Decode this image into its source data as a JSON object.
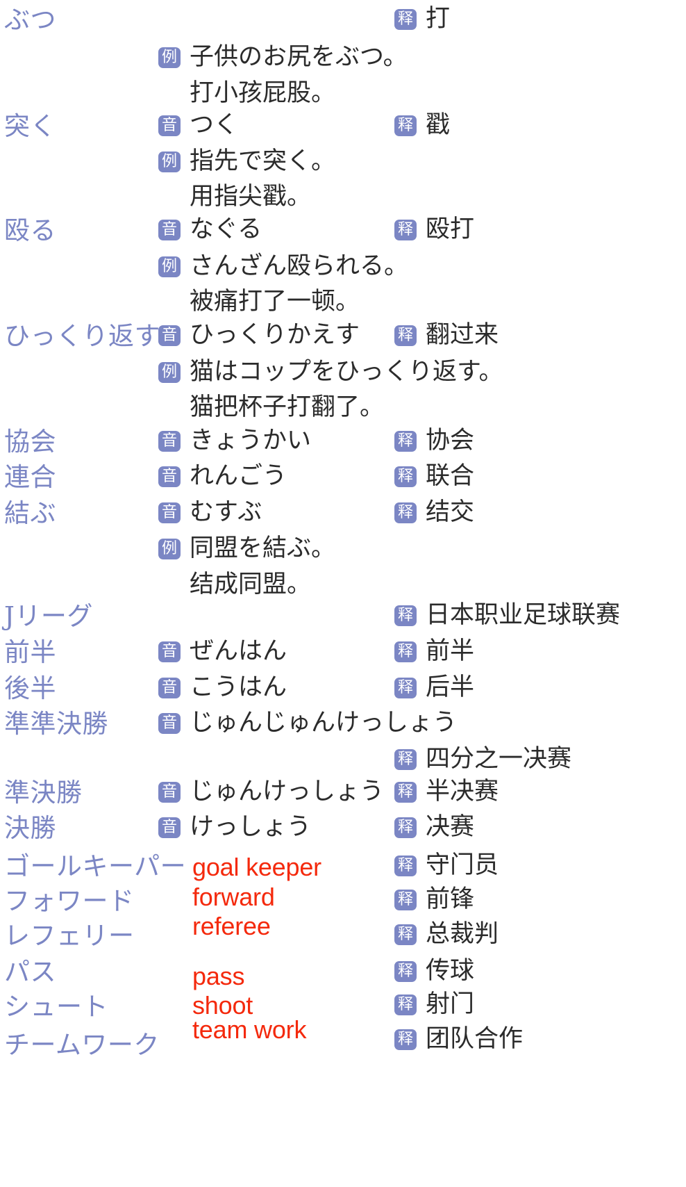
{
  "badges": {
    "reading": "音",
    "example": "例",
    "gloss": "释"
  },
  "colors": {
    "headword": "#7b86c4",
    "badge_bg": "#7b86c4",
    "body_text": "#2b2b2b",
    "annotation": "#f4290c",
    "page_bg": "#ffffff"
  },
  "entries": [
    {
      "headword": "ぶつ",
      "reading": "",
      "gloss": "打",
      "example_ja": "子供のお尻をぶつ。",
      "example_zh": "打小孩屁股。",
      "annotation": ""
    },
    {
      "headword": "突く",
      "reading": "つく",
      "gloss": "戳",
      "example_ja": "指先で突く。",
      "example_zh": "用指尖戳。",
      "annotation": ""
    },
    {
      "headword": "殴る",
      "reading": "なぐる",
      "gloss": "殴打",
      "example_ja": "さんざん殴られる。",
      "example_zh": "被痛打了一顿。",
      "annotation": ""
    },
    {
      "headword": "ひっくり返す",
      "reading": "ひっくりかえす",
      "gloss": "翻过来",
      "example_ja": "猫はコップをひっくり返す。",
      "example_zh": "猫把杯子打翻了。",
      "annotation": ""
    },
    {
      "headword": "協会",
      "reading": "きょうかい",
      "gloss": "协会",
      "example_ja": "",
      "example_zh": "",
      "annotation": ""
    },
    {
      "headword": "連合",
      "reading": "れんごう",
      "gloss": "联合",
      "example_ja": "",
      "example_zh": "",
      "annotation": ""
    },
    {
      "headword": "結ぶ",
      "reading": "むすぶ",
      "gloss": "结交",
      "example_ja": "同盟を結ぶ。",
      "example_zh": "结成同盟。",
      "annotation": ""
    },
    {
      "headword": "Jリーグ",
      "reading": "",
      "gloss": "日本职业足球联赛",
      "example_ja": "",
      "example_zh": "",
      "annotation": ""
    },
    {
      "headword": "前半",
      "reading": "ぜんはん",
      "gloss": "前半",
      "example_ja": "",
      "example_zh": "",
      "annotation": ""
    },
    {
      "headword": "後半",
      "reading": "こうはん",
      "gloss": "后半",
      "example_ja": "",
      "example_zh": "",
      "annotation": ""
    },
    {
      "headword": "準準決勝",
      "reading": "じゅんじゅんけっしょう",
      "gloss": "四分之一决赛",
      "example_ja": "",
      "example_zh": "",
      "annotation": ""
    },
    {
      "headword": "準決勝",
      "reading": "じゅんけっしょう",
      "gloss": "半决赛",
      "example_ja": "",
      "example_zh": "",
      "annotation": ""
    },
    {
      "headword": "決勝",
      "reading": "けっしょう",
      "gloss": "决赛",
      "example_ja": "",
      "example_zh": "",
      "annotation": ""
    },
    {
      "headword": "ゴールキーパー",
      "reading": "",
      "gloss": "守门员",
      "example_ja": "",
      "example_zh": "",
      "annotation": "goal keeper"
    },
    {
      "headword": "フォワード",
      "reading": "",
      "gloss": "前锋",
      "example_ja": "",
      "example_zh": "",
      "annotation": "forward"
    },
    {
      "headword": "レフェリー",
      "reading": "",
      "gloss": "总裁判",
      "example_ja": "",
      "example_zh": "",
      "annotation": "referee"
    },
    {
      "headword": "パス",
      "reading": "",
      "gloss": "传球",
      "example_ja": "",
      "example_zh": "",
      "annotation": "pass"
    },
    {
      "headword": "シュート",
      "reading": "",
      "gloss": "射门",
      "example_ja": "",
      "example_zh": "",
      "annotation": "shoot"
    },
    {
      "headword": "チームワーク",
      "reading": "",
      "gloss": "团队合作",
      "example_ja": "",
      "example_zh": "",
      "annotation": "team work"
    }
  ]
}
